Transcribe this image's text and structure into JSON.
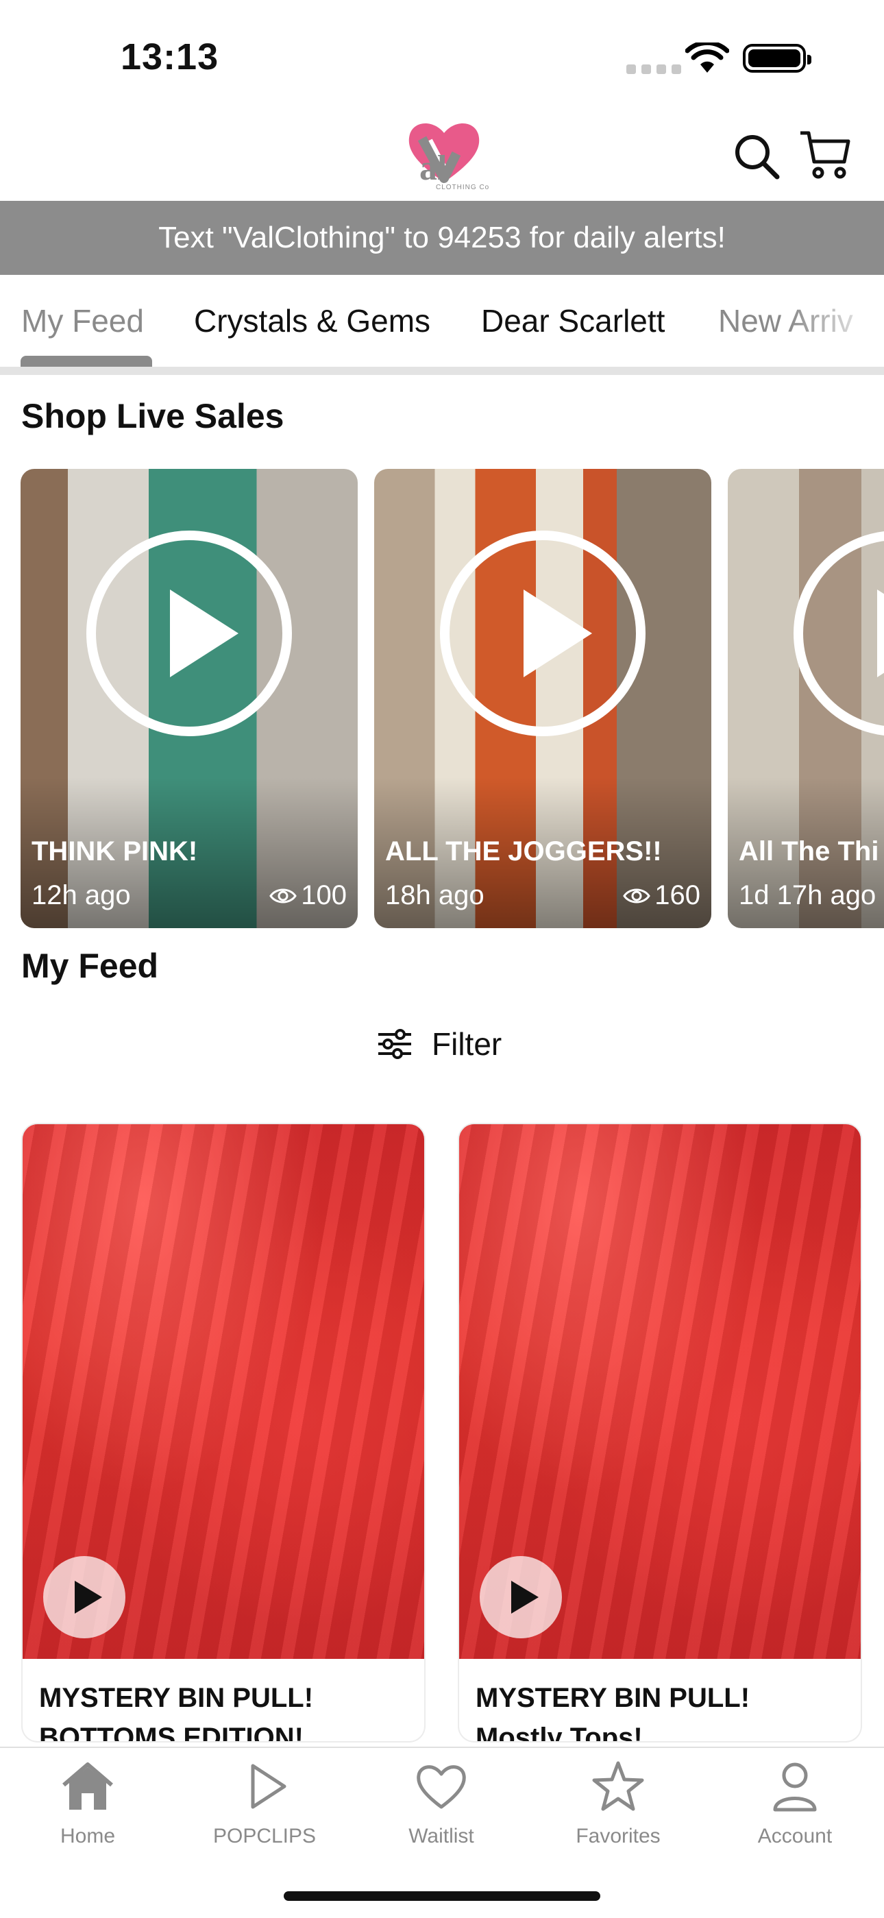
{
  "status_bar": {
    "time": "13:13"
  },
  "header": {
    "logo_text": "al",
    "logo_sub": "CLOTHING Co",
    "icons": [
      "search-icon",
      "cart-icon"
    ]
  },
  "banner": {
    "text": "Text \"ValClothing\" to 94253 for daily alerts!"
  },
  "tabs": [
    {
      "label": "My Feed",
      "active": true
    },
    {
      "label": "Crystals & Gems"
    },
    {
      "label": "Dear Scarlett"
    },
    {
      "label": "New Arriv"
    }
  ],
  "live_section": {
    "title": "Shop Live Sales",
    "cards": [
      {
        "title": "THINK PINK!",
        "ago": "12h ago",
        "views": "100"
      },
      {
        "title": "ALL THE JOGGERS!!",
        "ago": "18h ago",
        "views": "160"
      },
      {
        "title": "All The Thi",
        "ago": "1d 17h ago",
        "views": ""
      }
    ]
  },
  "feed_section": {
    "title": "My Feed",
    "filter_label": "Filter",
    "cards": [
      {
        "caption_line1": "MYSTERY BIN PULL!",
        "caption_line2": "BOTTOMS EDITION!"
      },
      {
        "caption_line1": "MYSTERY BIN PULL!",
        "caption_line2": "Mostly Tops!"
      }
    ]
  },
  "bottom_nav": [
    {
      "label": "Home",
      "icon": "home-icon"
    },
    {
      "label": "POPCLIPS",
      "icon": "play-icon"
    },
    {
      "label": "Waitlist",
      "icon": "heart-icon"
    },
    {
      "label": "Favorites",
      "icon": "star-icon"
    },
    {
      "label": "Account",
      "icon": "person-icon"
    }
  ],
  "colors": {
    "banner": "#8c8c8c",
    "accent_pink": "#e85a8a",
    "gray": "#8a8a8a"
  }
}
